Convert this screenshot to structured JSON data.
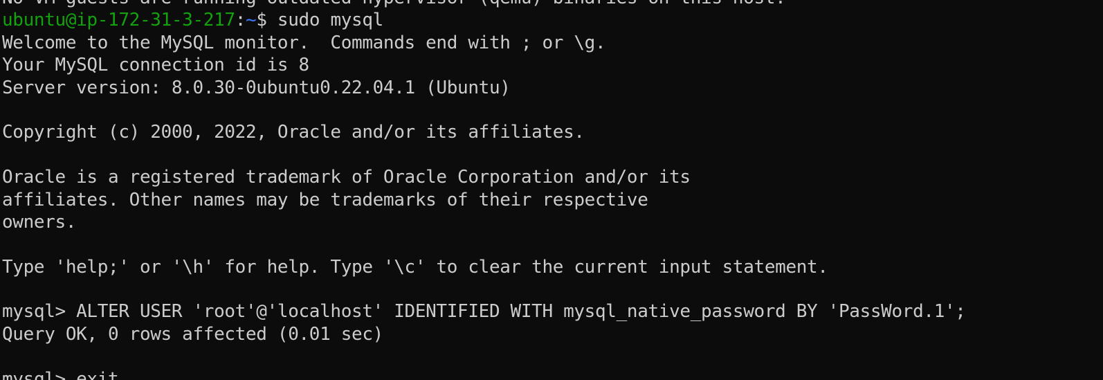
{
  "terminal": {
    "colors": {
      "background": "#0c0c0c",
      "foreground": "#cccccc",
      "prompt_user": "#13a10e",
      "prompt_path": "#3b78ff"
    },
    "lines": {
      "cut_top": "No VM guests are running outdated hypervisor (qemu) binaries on this host.",
      "shell_prompt": {
        "user_host": "ubuntu@ip-172-31-3-217",
        "colon": ":",
        "path": "~",
        "dollar": "$ ",
        "command": "sudo mysql"
      },
      "welcome": "Welcome to the MySQL monitor.  Commands end with ; or \\g.",
      "connection_id": "Your MySQL connection id is 8",
      "server_version": "Server version: 8.0.30-0ubuntu0.22.04.1 (Ubuntu)",
      "copyright": "Copyright (c) 2000, 2022, Oracle and/or its affiliates.",
      "trademark_1": "Oracle is a registered trademark of Oracle Corporation and/or its",
      "trademark_2": "affiliates. Other names may be trademarks of their respective",
      "trademark_3": "owners.",
      "help_hint": "Type 'help;' or '\\h' for help. Type '\\c' to clear the current input statement.",
      "mysql_command": "mysql> ALTER USER 'root'@'localhost' IDENTIFIED WITH mysql_native_password BY 'PassWord.1';",
      "query_result": "Query OK, 0 rows affected (0.01 sec)",
      "cut_bottom": "mysql> exit"
    }
  }
}
